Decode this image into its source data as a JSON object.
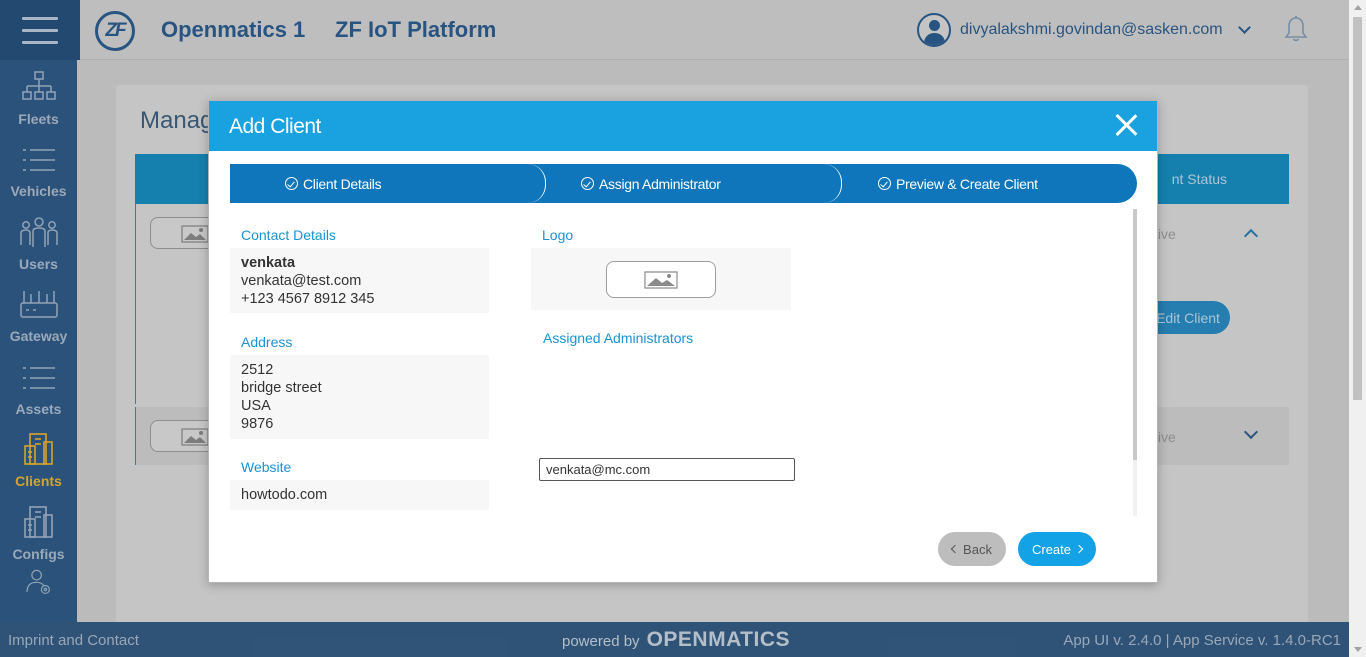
{
  "header": {
    "app_title": "Openmatics 1",
    "platform_title": "ZF IoT Platform",
    "logo_text": "ZF",
    "user_email": "divyalakshmi.govindan@sasken.com"
  },
  "sidebar": {
    "items": [
      {
        "label": "Fleets",
        "icon": "fleets-icon"
      },
      {
        "label": "Vehicles",
        "icon": "vehicles-icon"
      },
      {
        "label": "Users",
        "icon": "users-icon"
      },
      {
        "label": "Gateway",
        "icon": "gateway-icon"
      },
      {
        "label": "Assets",
        "icon": "assets-icon"
      },
      {
        "label": "Clients",
        "icon": "clients-icon",
        "active": true
      },
      {
        "label": "Configs",
        "icon": "configs-icon"
      }
    ]
  },
  "background": {
    "page_title": "Manag",
    "column_status": "nt Status",
    "row1_status": "tive",
    "row2_status": "tive",
    "edit_client": "Edit Client"
  },
  "modal": {
    "title": "Add Client",
    "steps": [
      "Client Details",
      "Assign Administrator",
      "Preview & Create Client"
    ],
    "contact": {
      "label": "Contact Details",
      "name": "venkata",
      "email": "venkata@test.com",
      "phone": "+123 4567 8912 345"
    },
    "address": {
      "label": "Address",
      "lines": [
        "2512",
        "bridge street",
        "USA",
        "9876"
      ]
    },
    "website": {
      "label": "Website",
      "value": "howtodo.com"
    },
    "logo_label": "Logo",
    "admins": {
      "label": "Assigned Administrators",
      "value": "venkata@mc.com"
    },
    "back_label": "Back",
    "create_label": "Create"
  },
  "footer": {
    "left": "Imprint and Contact",
    "powered_by": "powered by",
    "brand": "OPENMATICS",
    "version": "App UI v. 2.4.0 | App Service v. 1.4.0-RC1"
  },
  "colors": {
    "sidebar": "#2e5a86",
    "modal_header": "#1aa1df",
    "stepper": "#0f76bc",
    "active_nav": "#e6b32e",
    "create_button": "#14a2e6"
  }
}
